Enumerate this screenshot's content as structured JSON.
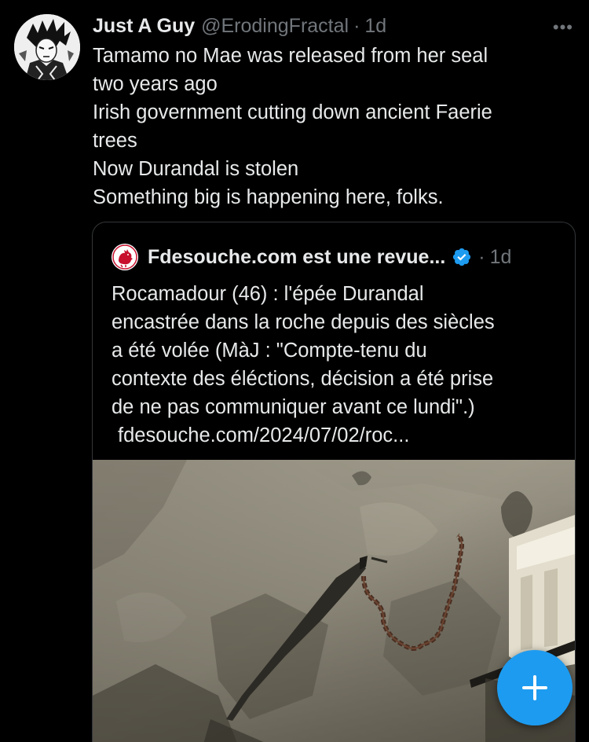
{
  "tweet": {
    "author": {
      "display_name": "Just A Guy",
      "handle": "@ErodingFractal",
      "separator": "·",
      "time": "1d",
      "avatar_icon": "manga-character-avatar"
    },
    "more_icon": "more-options-icon",
    "more_label": "•••",
    "text_lines": [
      "Tamamo no Mae was released from her seal",
      "two years ago",
      "Irish government cutting down ancient Faerie",
      "trees",
      "Now Durandal is stolen",
      "Something big is happening here, folks."
    ]
  },
  "quote": {
    "author": {
      "display_name": "Fdesouche.com est une revue...",
      "separator": "·",
      "time": "1d",
      "avatar_icon": "red-rooster-logo-icon",
      "verified_icon": "verified-badge-icon"
    },
    "text_lines": [
      "Rocamadour (46) : l'épée Durandal",
      "encastrée dans la roche depuis des siècles",
      "a été volée (MàJ : \"Compte-tenu du",
      "contexte des éléctions, décision a été prise",
      "de ne pas communiquer avant ce lundi\".)"
    ],
    "link": "fdesouche.com/2024/07/02/roc...",
    "image_icon": "sword-in-rock-photo"
  },
  "fab": {
    "label": "+",
    "icon": "compose-plus-icon"
  },
  "colors": {
    "background": "#000000",
    "primary_text": "#e7e9ea",
    "secondary_text": "#71767b",
    "accent": "#1d9bf0",
    "border": "#333639"
  }
}
